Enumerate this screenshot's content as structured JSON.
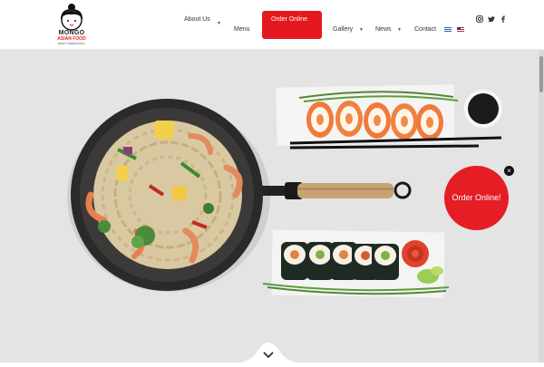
{
  "logo": {
    "name": "MONGO",
    "sub": "ASIAN FOOD",
    "tagline": "ENJOY FRESH DAILY"
  },
  "nav": {
    "about": "About Us",
    "menu": "Menu",
    "order": "Order Online",
    "gallery": "Gallery",
    "news": "News",
    "contact": "Contact"
  },
  "icons": [
    "instagram-icon",
    "twitter-icon",
    "facebook-icon",
    "greek-flag-icon",
    "us-flag-icon",
    "chevron-down-icon",
    "close-icon"
  ],
  "popup": {
    "label": "Order Online!"
  },
  "colors": {
    "accent": "#e4191f",
    "hero_bg": "#e4e4e4"
  }
}
